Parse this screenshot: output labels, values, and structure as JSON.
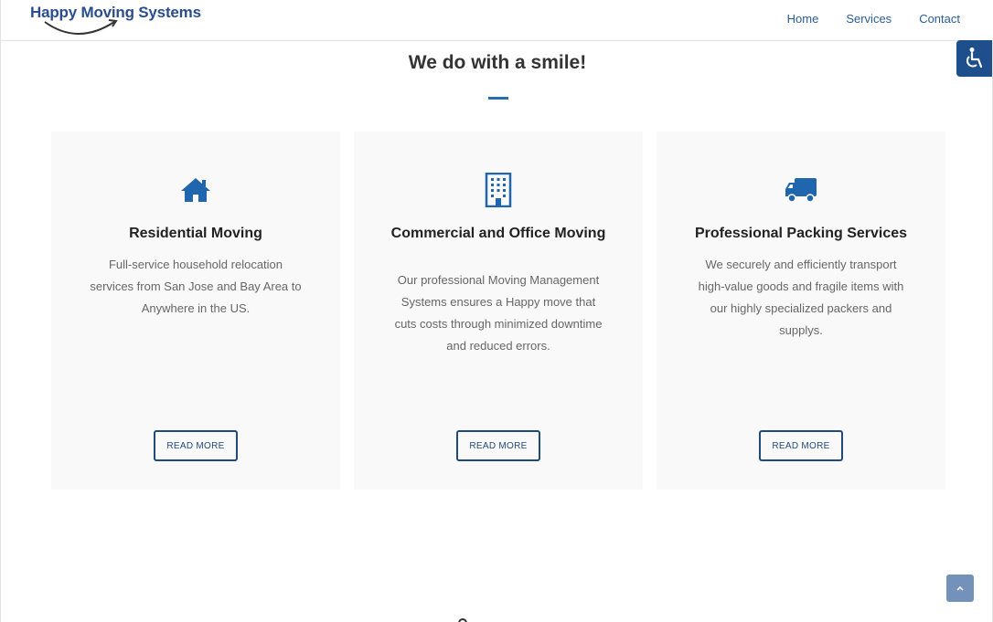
{
  "header": {
    "logo_text": "Happy Moving Systems",
    "nav": [
      {
        "label": "Home"
      },
      {
        "label": "Services"
      },
      {
        "label": "Contact"
      }
    ]
  },
  "section": {
    "title": "We do with a smile!"
  },
  "cards": [
    {
      "icon": "house-icon",
      "title": "Residential Moving",
      "description": "Full-service household relocation services from San Jose  and Bay Area to Anywhere in the US.",
      "button": "READ MORE"
    },
    {
      "icon": "office-building-icon",
      "title": "Commercial and Office Moving",
      "description": "Our professional Moving Management Systems ensures a Happy move that cuts costs through minimized downtime and reduced errors.",
      "button": "READ MORE"
    },
    {
      "icon": "truck-icon",
      "title": "Professional Packing Services",
      "description": "We securely and efficiently transport high-value goods and fragile items with our highly specialized packers and supplys.",
      "button": "READ MORE"
    }
  ],
  "colors": {
    "brand": "#2a4d8f",
    "accent": "#2470b0",
    "button_border": "#1f4a7a",
    "card_bg": "#f9f9f9"
  },
  "icons": [
    "accessibility-icon",
    "chevron-up-icon"
  ]
}
